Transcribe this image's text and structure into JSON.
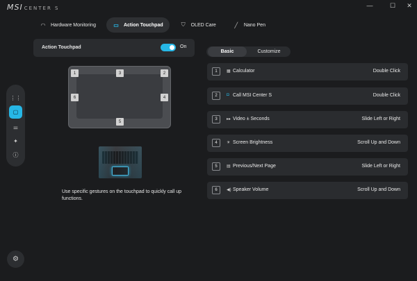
{
  "app": {
    "logo": "MSI",
    "logo_sub": "CENTER S"
  },
  "window_controls": {
    "minimize": "—",
    "maximize": "☐",
    "close": "✕"
  },
  "tabs": [
    {
      "label": "Hardware Monitoring",
      "icon": "gauge-icon",
      "active": false
    },
    {
      "label": "Action Touchpad",
      "icon": "touchpad-icon",
      "active": true
    },
    {
      "label": "OLED Care",
      "icon": "shield-icon",
      "active": false
    },
    {
      "label": "Nano Pen",
      "icon": "pen-icon",
      "active": false
    }
  ],
  "sidebar": {
    "items": [
      {
        "icon": "grid-icon",
        "glyph": "⋮⋮"
      },
      {
        "icon": "touchpad-icon",
        "glyph": "▢"
      },
      {
        "icon": "sliders-icon",
        "glyph": "⚌"
      },
      {
        "icon": "sparkle-icon",
        "glyph": "✦"
      },
      {
        "icon": "info-icon",
        "glyph": "ⓘ"
      }
    ],
    "settings_glyph": "⚙"
  },
  "toggle": {
    "label": "Action Touchpad",
    "state": "On",
    "on": true
  },
  "zones": [
    "1",
    "2",
    "3",
    "4",
    "5",
    "6"
  ],
  "description": "Use specific gestures on the touchpad to quickly call up functions.",
  "segment": {
    "basic": "Basic",
    "customize": "Customize",
    "selected": "Basic"
  },
  "gestures": [
    {
      "num": "1",
      "glyph": "▦",
      "icon": "calculator-icon",
      "name": "Calculator",
      "action": "Double Click"
    },
    {
      "num": "2",
      "glyph": "◘",
      "icon": "msi-center-icon",
      "name": "Call MSI Center S",
      "action": "Double Click"
    },
    {
      "num": "3",
      "glyph": "▸▸",
      "icon": "video-seek-icon",
      "name": "Video ± Seconds",
      "action": "Slide Left or Right"
    },
    {
      "num": "4",
      "glyph": "☀",
      "icon": "brightness-icon",
      "name": "Screen Brightness",
      "action": "Scroll Up and Down"
    },
    {
      "num": "5",
      "glyph": "▤",
      "icon": "page-icon",
      "name": "Previous/Next Page",
      "action": "Slide Left or Right"
    },
    {
      "num": "6",
      "glyph": "◀)",
      "icon": "speaker-icon",
      "name": "Speaker Volume",
      "action": "Scroll Up and Down"
    }
  ],
  "colors": {
    "accent": "#26b7e6",
    "background": "#1b1c1e",
    "panel": "#2a2c2f"
  }
}
